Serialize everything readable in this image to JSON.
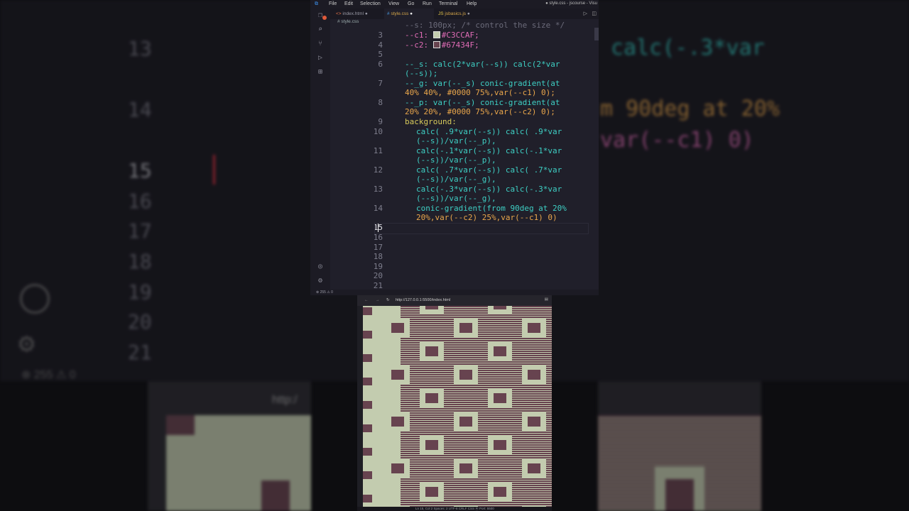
{
  "colors": {
    "c1": "#C3CCAF",
    "c2": "#67434F",
    "editor_bg": "#201f2a"
  },
  "titlebar": {
    "menus": [
      "File",
      "Edit",
      "Selection",
      "View",
      "Go",
      "Run",
      "Terminal",
      "Help"
    ],
    "window_title": "● style.css - jscourse - Visu"
  },
  "tabs": [
    {
      "label": "index.html",
      "modified": "●",
      "icon": "html-icon"
    },
    {
      "label": "style.css",
      "modified": "●",
      "icon": "css-icon",
      "active": true
    },
    {
      "label": "jsbasics.js",
      "modified": "●",
      "icon": "js-icon"
    }
  ],
  "breadcrumb": "# style.css",
  "editor": {
    "line_numbers": [
      "3",
      "4",
      "5",
      "6",
      "7",
      "8",
      "9",
      "10",
      "11",
      "12",
      "13",
      "14",
      "15",
      "16",
      "17",
      "18",
      "19",
      "20",
      "21"
    ],
    "current_line": "15",
    "top_partial": "--s: 100px; /* control the size */",
    "line3": {
      "prop": "--c1:",
      "value": "#C3CCAF;"
    },
    "line4": {
      "prop": "--c2:",
      "value": "#67434F;"
    },
    "line6a": "--_s: calc(2*var(--s)) calc(2*var",
    "line6b": "(--s));",
    "line7a": "--_g: var(--_s) conic-gradient(at",
    "line7b": "40% 40%, #0000 75%,var(--c1) 0);",
    "line8a": "--_p: var(--_s) conic-gradient(at",
    "line8b": "20% 20%, #0000 75%,var(--c2) 0);",
    "line9": "background:",
    "line10a": "calc( .9*var(--s)) calc( .9*var",
    "line10b": "(--s))/var(--_p),",
    "line11a": "calc(-.1*var(--s)) calc(-.1*var",
    "line11b": "(--s))/var(--_p),",
    "line12a": "calc( .7*var(--s)) calc( .7*var",
    "line12b": "(--s))/var(--_g),",
    "line13a": "calc(-.3*var(--s)) calc(-.3*var",
    "line13b": "(--s))/var(--_g),",
    "line14a": "conic-gradient(from 90deg at 20%",
    "line14b": "20%,var(--c2) 25%,var(--c1) 0)"
  },
  "statusbar": {
    "errors": "⊗ 255 ⚠ 0"
  },
  "browser": {
    "url": "http://127.0.0.1:5500/index.html",
    "status": "Ln 15, Col 2   Spaces: 2   UTF-8   CRLF   CSS   ⦿ Port: 5500"
  },
  "backdrop": {
    "line_numbers": [
      "13",
      "14",
      "15",
      "16",
      "17",
      "18",
      "19",
      "20",
      "21"
    ],
    "code_13": "calc(-.3*var",
    "code_14": "m 90deg at 20%",
    "code_14b": "var(--c1) 0)",
    "url": "http:/",
    "status": "⊗ 255 ⚠ 0"
  }
}
